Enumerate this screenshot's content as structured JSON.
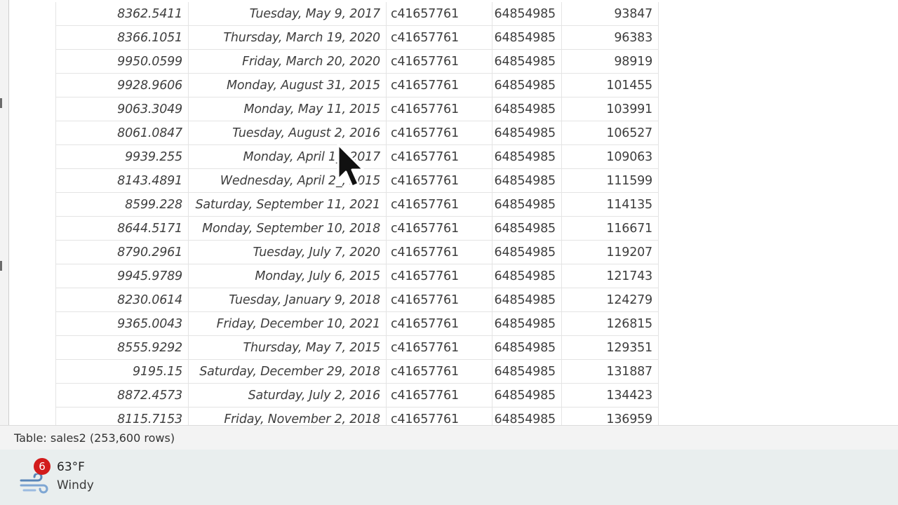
{
  "table": {
    "rows": [
      [
        "8362.5411",
        "Tuesday, May 9, 2017",
        "c41657761",
        "64854985",
        "93847"
      ],
      [
        "8366.1051",
        "Thursday, March 19, 2020",
        "c41657761",
        "64854985",
        "96383"
      ],
      [
        "9950.0599",
        "Friday, March 20, 2020",
        "c41657761",
        "64854985",
        "98919"
      ],
      [
        "9928.9606",
        "Monday, August 31, 2015",
        "c41657761",
        "64854985",
        "101455"
      ],
      [
        "9063.3049",
        "Monday, May 11, 2015",
        "c41657761",
        "64854985",
        "103991"
      ],
      [
        "8061.0847",
        "Tuesday, August 2, 2016",
        "c41657761",
        "64854985",
        "106527"
      ],
      [
        "9939.255",
        "Monday, April 1_, 2017",
        "c41657761",
        "64854985",
        "109063"
      ],
      [
        "8143.4891",
        "Wednesday, April 2_, 2015",
        "c41657761",
        "64854985",
        "111599"
      ],
      [
        "8599.228",
        "Saturday, September 11, 2021",
        "c41657761",
        "64854985",
        "114135"
      ],
      [
        "8644.5171",
        "Monday, September 10, 2018",
        "c41657761",
        "64854985",
        "116671"
      ],
      [
        "8790.2961",
        "Tuesday, July 7, 2020",
        "c41657761",
        "64854985",
        "119207"
      ],
      [
        "9945.9789",
        "Monday, July 6, 2015",
        "c41657761",
        "64854985",
        "121743"
      ],
      [
        "8230.0614",
        "Tuesday, January 9, 2018",
        "c41657761",
        "64854985",
        "124279"
      ],
      [
        "9365.0043",
        "Friday, December 10, 2021",
        "c41657761",
        "64854985",
        "126815"
      ],
      [
        "8555.9292",
        "Thursday, May 7, 2015",
        "c41657761",
        "64854985",
        "129351"
      ],
      [
        "9195.15",
        "Saturday, December 29, 2018",
        "c41657761",
        "64854985",
        "131887"
      ],
      [
        "8872.4573",
        "Saturday, July 2, 2016",
        "c41657761",
        "64854985",
        "134423"
      ],
      [
        "8115.7153",
        "Friday, November 2, 2018",
        "c41657761",
        "64854985",
        "136959"
      ]
    ]
  },
  "status_bar": {
    "text": "Table: sales2 (253,600 rows)"
  },
  "taskbar": {
    "weather": {
      "badge_count": "6",
      "temperature": "63°F",
      "condition": "Windy",
      "icon": "wind-icon"
    }
  },
  "colors": {
    "notification_badge": "#d21b1b",
    "grid_line": "#e4e4e4",
    "cell_text": "#3e3e3e",
    "taskbar_bg": "#e9eeee"
  }
}
